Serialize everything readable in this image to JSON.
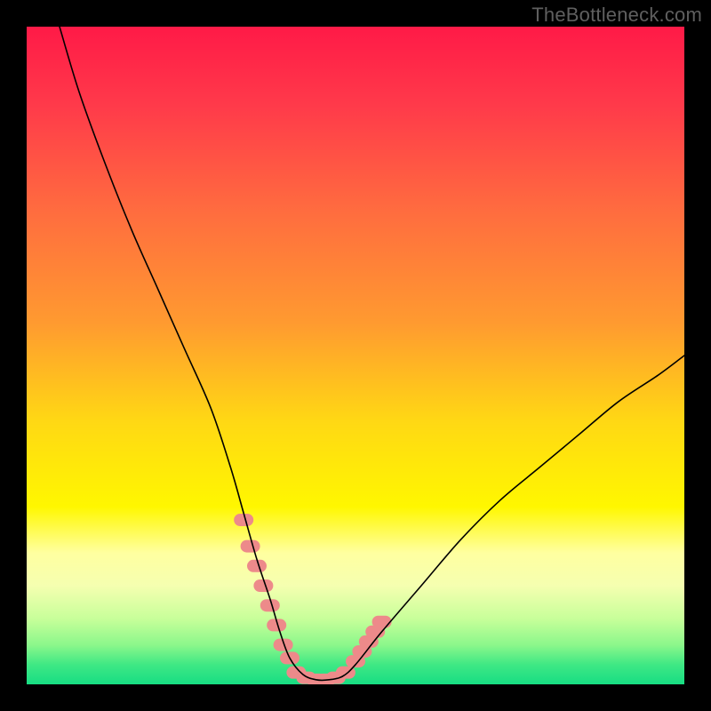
{
  "watermark": "TheBottleneck.com",
  "chart_data": {
    "type": "line",
    "title": "",
    "xlabel": "",
    "ylabel": "",
    "legend": false,
    "grid": false,
    "xlim": [
      0,
      100
    ],
    "ylim": [
      0,
      100
    ],
    "background_gradient": {
      "direction": "vertical",
      "stops": [
        {
          "pos": 0.0,
          "color": "#ff1a47"
        },
        {
          "pos": 0.12,
          "color": "#ff3a4a"
        },
        {
          "pos": 0.28,
          "color": "#ff6c3f"
        },
        {
          "pos": 0.45,
          "color": "#ff9a30"
        },
        {
          "pos": 0.6,
          "color": "#ffd814"
        },
        {
          "pos": 0.73,
          "color": "#fff700"
        },
        {
          "pos": 0.8,
          "color": "#ffffa0"
        },
        {
          "pos": 0.85,
          "color": "#f5ffb0"
        },
        {
          "pos": 0.9,
          "color": "#c8ff9a"
        },
        {
          "pos": 0.94,
          "color": "#8cf78b"
        },
        {
          "pos": 0.97,
          "color": "#3fe884"
        },
        {
          "pos": 1.0,
          "color": "#17dd83"
        }
      ]
    },
    "series": [
      {
        "name": "bottleneck-curve",
        "color": "#000000",
        "stroke_width": 1.6,
        "x": [
          5,
          8,
          12,
          16,
          20,
          24,
          28,
          31,
          33,
          35,
          37,
          38.5,
          40,
          42,
          44,
          46,
          48,
          50,
          54,
          60,
          66,
          72,
          78,
          84,
          90,
          96,
          100
        ],
        "values": [
          100,
          90,
          79,
          69,
          60,
          51,
          42,
          33,
          26,
          19,
          13,
          8,
          4,
          1.5,
          0.7,
          0.7,
          1.2,
          3,
          8,
          15,
          22,
          28,
          33,
          38,
          43,
          47,
          50
        ]
      }
    ],
    "markers": [
      {
        "name": "left-cluster",
        "color": "#ed8a8a",
        "shape": "capsule",
        "points": [
          {
            "x": 33.0,
            "y": 25
          },
          {
            "x": 34.0,
            "y": 21
          },
          {
            "x": 35.0,
            "y": 18
          },
          {
            "x": 36.0,
            "y": 15
          },
          {
            "x": 37.0,
            "y": 12
          },
          {
            "x": 38.0,
            "y": 9
          },
          {
            "x": 39.0,
            "y": 6
          },
          {
            "x": 40.0,
            "y": 4
          }
        ]
      },
      {
        "name": "bottom-cluster",
        "color": "#ed8a8a",
        "shape": "capsule",
        "points": [
          {
            "x": 41.0,
            "y": 1.8
          },
          {
            "x": 42.5,
            "y": 1.0
          },
          {
            "x": 44.0,
            "y": 0.7
          },
          {
            "x": 45.5,
            "y": 0.7
          },
          {
            "x": 47.0,
            "y": 1.0
          },
          {
            "x": 48.5,
            "y": 1.8
          }
        ]
      },
      {
        "name": "right-cluster",
        "color": "#ed8a8a",
        "shape": "capsule",
        "points": [
          {
            "x": 50.0,
            "y": 3.5
          },
          {
            "x": 51.0,
            "y": 5.0
          },
          {
            "x": 52.0,
            "y": 6.5
          },
          {
            "x": 53.0,
            "y": 8.0
          },
          {
            "x": 54.0,
            "y": 9.5
          }
        ]
      }
    ]
  }
}
